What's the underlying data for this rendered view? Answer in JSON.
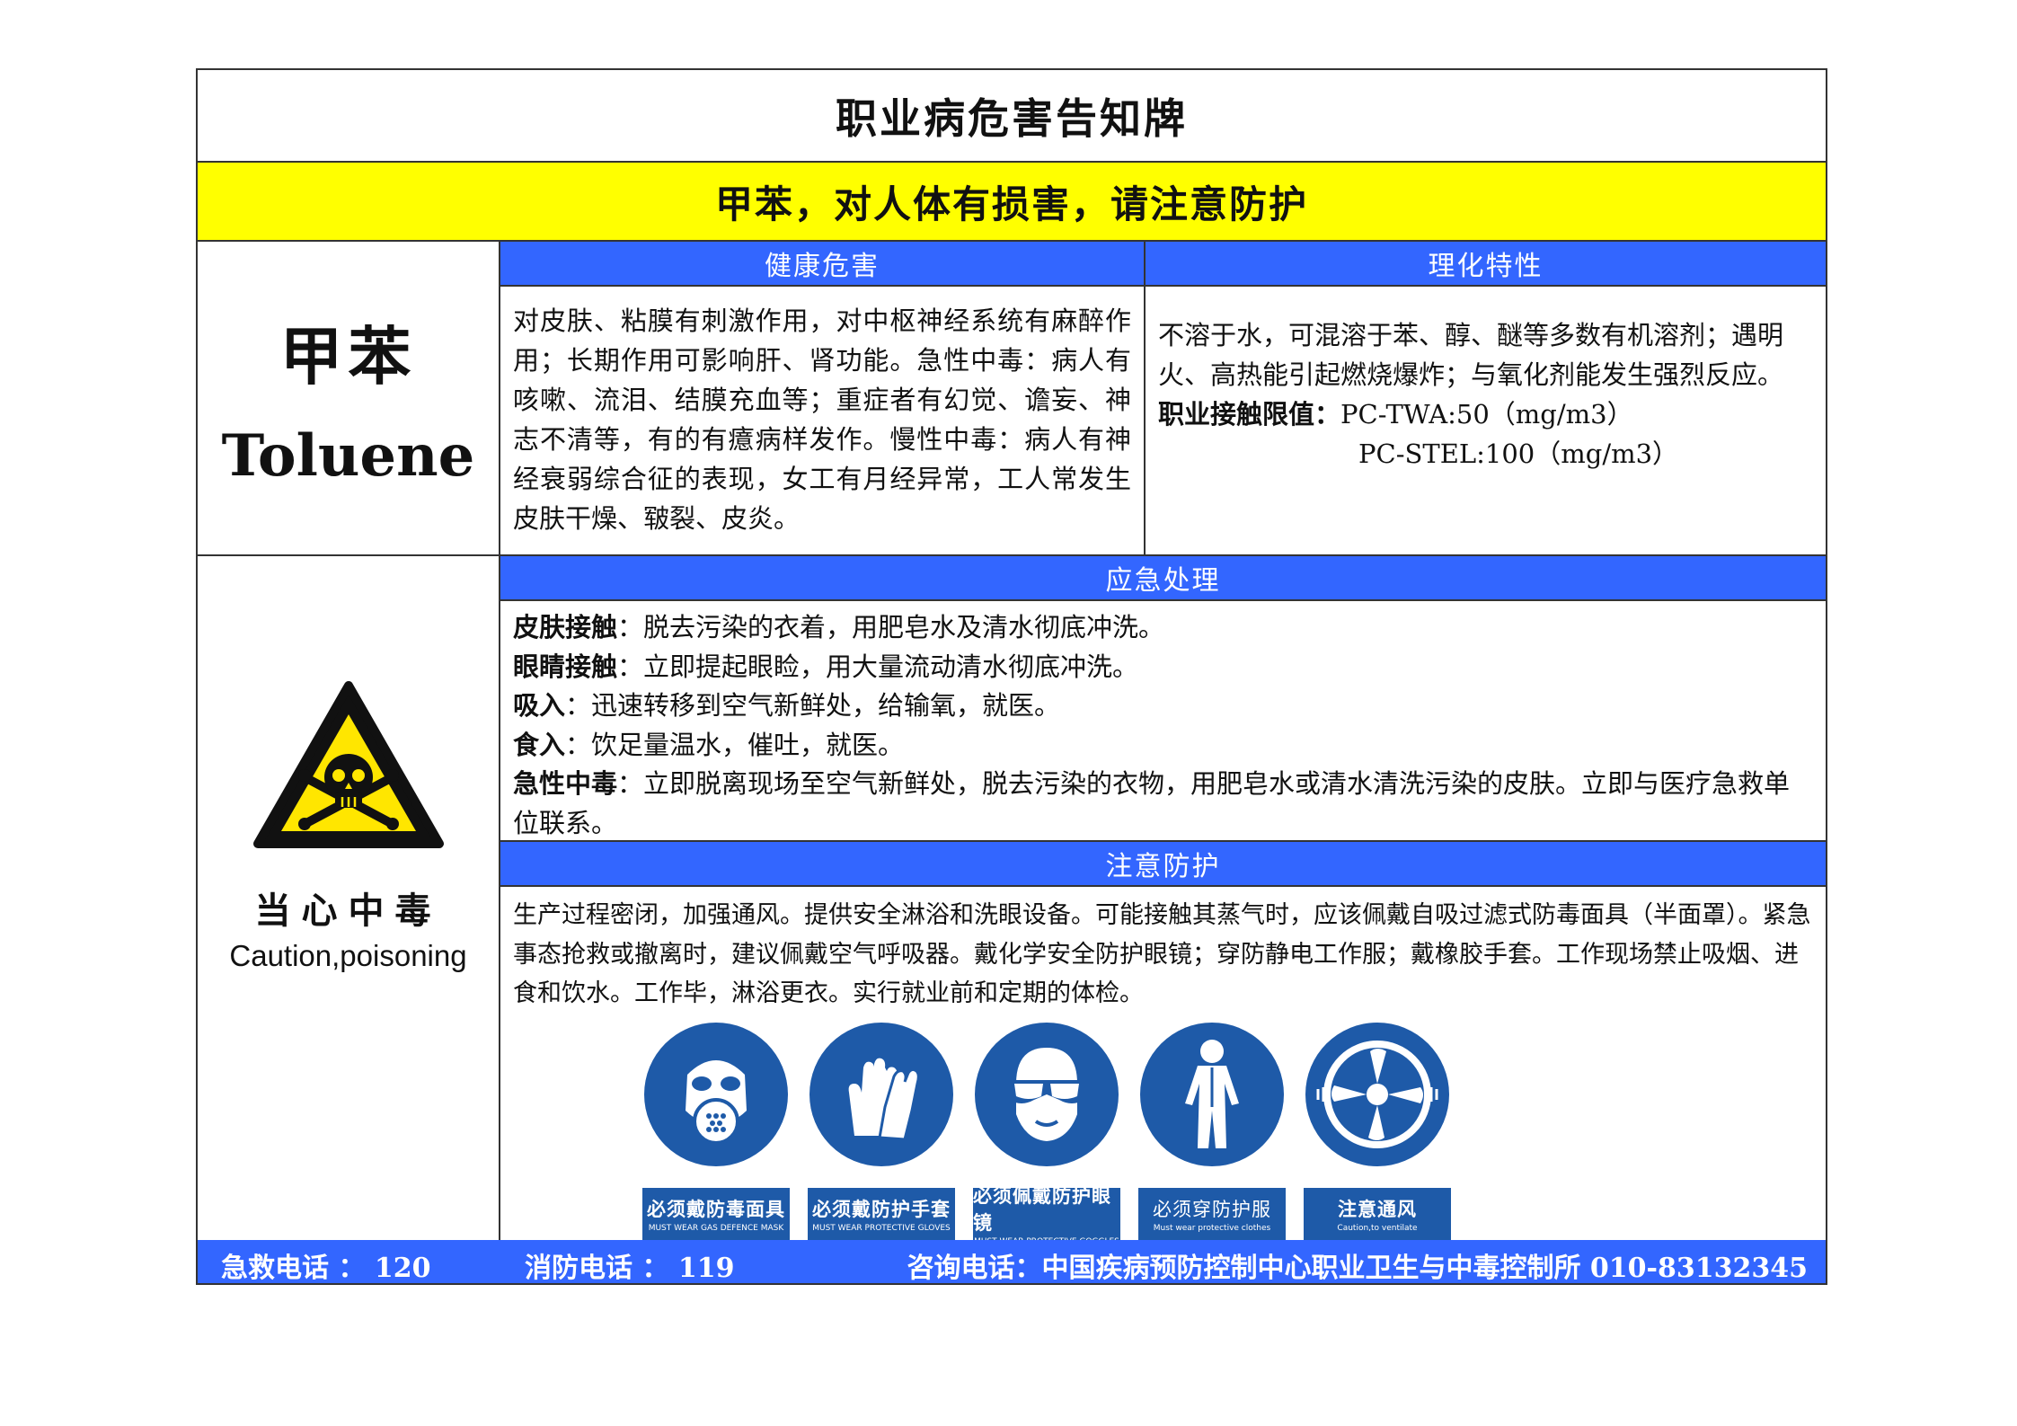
{
  "title": "职业病危害告知牌",
  "warning": "甲苯，对人体有损害，请注意防护",
  "substance": {
    "name_cn": "甲苯",
    "name_en": "Toluene"
  },
  "health": {
    "heading": "健康危害",
    "text": "对皮肤、粘膜有刺激作用，对中枢神经系统有麻醉作用；长期作用可影响肝、肾功能。急性中毒：病人有咳嗽、流泪、结膜充血等；重症者有幻觉、谵妄、神志不清等，有的有癔病样发作。慢性中毒：病人有神经衰弱综合征的表现，女工有月经异常，工人常发生皮肤干燥、皲裂、皮炎。"
  },
  "physical": {
    "heading": "理化特性",
    "text": "不溶于水，可混溶于苯、醇、醚等多数有机溶剂；遇明火、高热能引起燃烧爆炸；与氧化剂能发生强烈反应。",
    "limit_label": "职业接触限值：",
    "limit_twa": "PC-TWA:50（mg/m3）",
    "limit_stel": "PC-STEL:100（mg/m3）"
  },
  "sign": {
    "label_cn": "当心中毒",
    "label_en": "Caution,poisoning",
    "icon": "skull-crossbones-icon",
    "color": "#ffe600"
  },
  "emergency": {
    "heading": "应急处理",
    "items": [
      {
        "key": "皮肤接触",
        "text": "：脱去污染的衣着，用肥皂水及清水彻底冲洗。"
      },
      {
        "key": "眼睛接触",
        "text": "：立即提起眼睑，用大量流动清水彻底冲洗。"
      },
      {
        "key": "吸入",
        "text": "：迅速转移到空气新鲜处，给输氧，就医。"
      },
      {
        "key": "食入",
        "text": "：饮足量温水，催吐，就医。"
      },
      {
        "key": "急性中毒",
        "text": "：立即脱离现场至空气新鲜处，脱去污染的衣物，用肥皂水或清水清洗污染的皮肤。立即与医疗急救单位联系。"
      }
    ]
  },
  "protection": {
    "heading": "注意防护",
    "text": "生产过程密闭，加强通风。提供安全淋浴和洗眼设备。可能接触其蒸气时，应该佩戴自吸过滤式防毒面具（半面罩）。紧急事态抢救或撤离时，建议佩戴空气呼吸器。戴化学安全防护眼镜；穿防静电工作服；戴橡胶手套。工作现场禁止吸烟、进食和饮水。工作毕，淋浴更衣。实行就业前和定期的体检。",
    "icons": [
      {
        "icon": "gas-mask-icon",
        "cn": "必须戴防毒面具",
        "en": "MUST WEAR GAS DEFENCE MASK"
      },
      {
        "icon": "gloves-icon",
        "cn": "必须戴防护手套",
        "en": "MUST WEAR PROTECTIVE GLOVES"
      },
      {
        "icon": "goggles-icon",
        "cn": "必须佩戴防护眼镜",
        "en": "MUST WEAR PROTECTIVE GOGGLES"
      },
      {
        "icon": "protective-clothes-icon",
        "cn": "必须穿防护服",
        "en": "Must wear protective clothes"
      },
      {
        "icon": "ventilation-fan-icon",
        "cn": "注意通风",
        "en": "Caution,to ventilate"
      }
    ],
    "icon_color": "#1e5aa8"
  },
  "footer": {
    "first_aid": "急救电话 ： 120",
    "fire": "消防电话 ： 119",
    "consult": "咨询电话：中国疾病预防控制中心职业卫生与中毒控制所 010-83132345"
  }
}
